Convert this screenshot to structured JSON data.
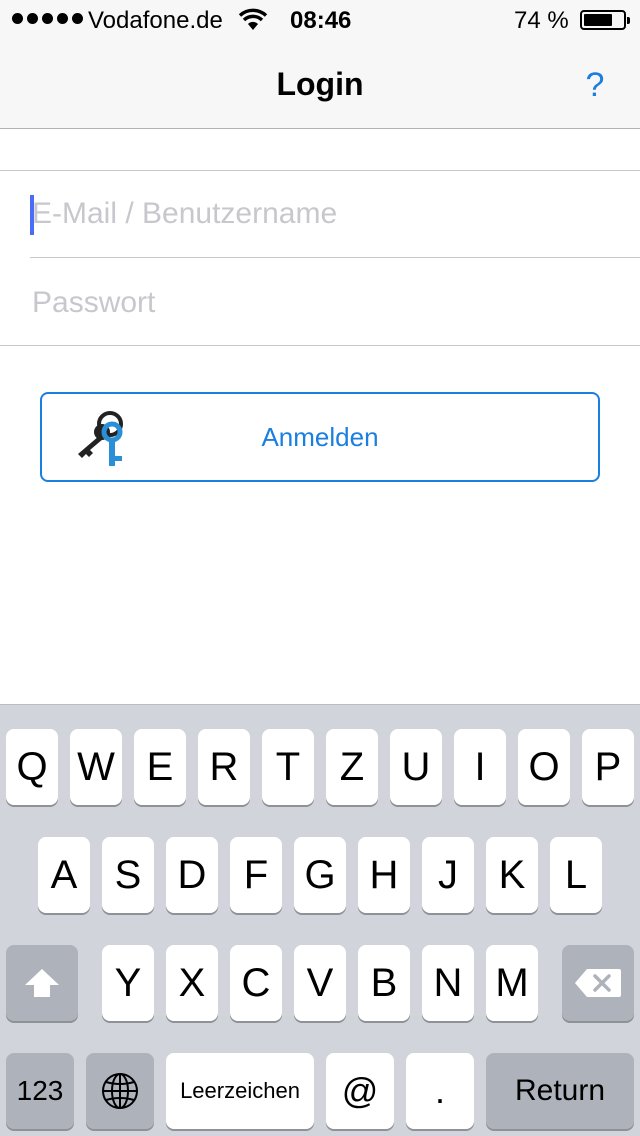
{
  "status_bar": {
    "carrier": "Vodafone.de",
    "time": "08:46",
    "battery_percent_text": "74 %",
    "battery_level": 0.74,
    "signal_bars": 5
  },
  "nav": {
    "title": "Login",
    "help_label": "?"
  },
  "form": {
    "email_placeholder": "E-Mail / Benutzername",
    "email_value": "",
    "password_placeholder": "Passwort",
    "password_value": ""
  },
  "login_button": {
    "label": "Anmelden",
    "icon": "keys-icon"
  },
  "keyboard": {
    "row1": [
      "Q",
      "W",
      "E",
      "R",
      "T",
      "Z",
      "U",
      "I",
      "O",
      "P"
    ],
    "row2": [
      "A",
      "S",
      "D",
      "F",
      "G",
      "H",
      "J",
      "K",
      "L"
    ],
    "row3": [
      "Y",
      "X",
      "C",
      "V",
      "B",
      "N",
      "M"
    ],
    "numbers_label": "123",
    "space_label": "Leerzeichen",
    "at_label": "@",
    "dot_label": ".",
    "return_label": "Return",
    "shift_icon": "shift-icon",
    "delete_icon": "backspace-icon",
    "globe_icon": "globe-icon"
  },
  "colors": {
    "accent": "#1a7fe0",
    "caret": "#4a6cf7",
    "keyboard_bg": "#d1d5db",
    "key_dark": "#aeb3bb"
  }
}
